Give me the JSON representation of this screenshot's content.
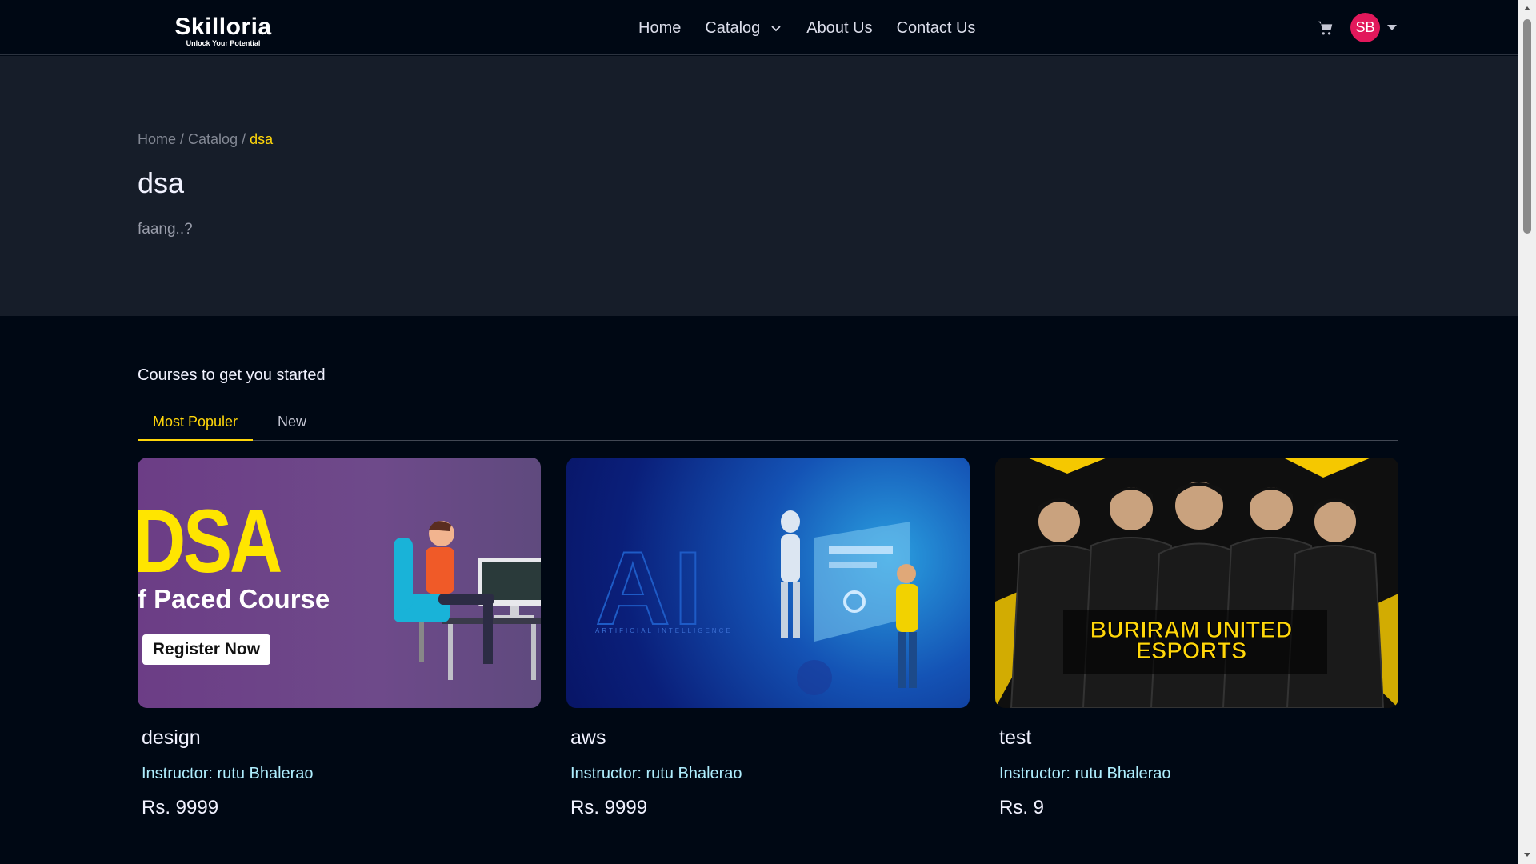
{
  "brand": {
    "name": "Skilloria",
    "tagline": "Unlock Your Potential"
  },
  "nav": {
    "links": [
      "Home",
      "Catalog",
      "About Us",
      "Contact Us"
    ],
    "avatar_initials": "SB"
  },
  "breadcrumb": {
    "home": "Home",
    "catalog": "Catalog",
    "current": "dsa",
    "separator": " / "
  },
  "category": {
    "title": "dsa",
    "description": "faang..?"
  },
  "courses_section": {
    "heading": "Courses to get you started",
    "tabs": [
      "Most Populer",
      "New"
    ],
    "active_tab": "Most Populer"
  },
  "courses": [
    {
      "title": "design",
      "instructor": "Instructor: rutu Bhalerao",
      "price": "Rs. 9999",
      "thumb": {
        "big": "DSA",
        "sub": "f Paced Course",
        "cta": "Register Now"
      }
    },
    {
      "title": "aws",
      "instructor": "Instructor: rutu Bhalerao",
      "price": "Rs. 9999",
      "thumb": {
        "big": "AI",
        "sub": "ARTIFICIAL INTELLIGENCE"
      }
    },
    {
      "title": "test",
      "instructor": "Instructor: rutu Bhalerao",
      "price": "Rs. 9",
      "thumb": {
        "banner": "BURIRAM UNITED ESPORTS"
      }
    }
  ],
  "colors": {
    "accent": "#ffd60a",
    "avatar_bg": "#e2185b",
    "instructor_text": "#afeefe",
    "hero_bg": "#161d29",
    "page_bg": "#000814"
  }
}
